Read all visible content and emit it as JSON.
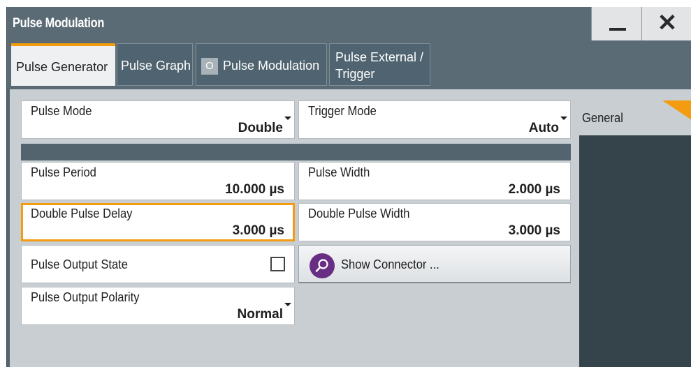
{
  "window": {
    "title": "Pulse Modulation",
    "minimize_glyph": "—",
    "close_glyph": "✕"
  },
  "tabs": [
    {
      "label": "Pulse Generator",
      "active": true
    },
    {
      "label": "Pulse Graph",
      "active": false
    },
    {
      "label": "Pulse Modulation",
      "active": false,
      "state_indicator": "O"
    },
    {
      "label": "Pulse External / Trigger",
      "active": false
    }
  ],
  "fields": {
    "pulse_mode": {
      "label": "Pulse Mode",
      "value": "Double"
    },
    "trigger_mode": {
      "label": "Trigger Mode",
      "value": "Auto"
    },
    "pulse_period": {
      "label": "Pulse Period",
      "value": "10.000 µs"
    },
    "pulse_width": {
      "label": "Pulse Width",
      "value": "2.000 µs"
    },
    "double_pulse_delay": {
      "label": "Double Pulse Delay",
      "value": "3.000 µs"
    },
    "double_pulse_width": {
      "label": "Double Pulse Width",
      "value": "3.000 µs"
    },
    "pulse_output_state": {
      "label": "Pulse Output State",
      "checked": false
    },
    "pulse_output_polarity": {
      "label": "Pulse Output Polarity",
      "value": "Normal"
    }
  },
  "show_connector": {
    "label": "Show Connector ...",
    "icon": "search-icon"
  },
  "side_panel": {
    "general_label": "General"
  },
  "colors": {
    "accent": "#f39c12",
    "titlebar": "#5b6b75",
    "connector_icon": "#6a2d84"
  }
}
